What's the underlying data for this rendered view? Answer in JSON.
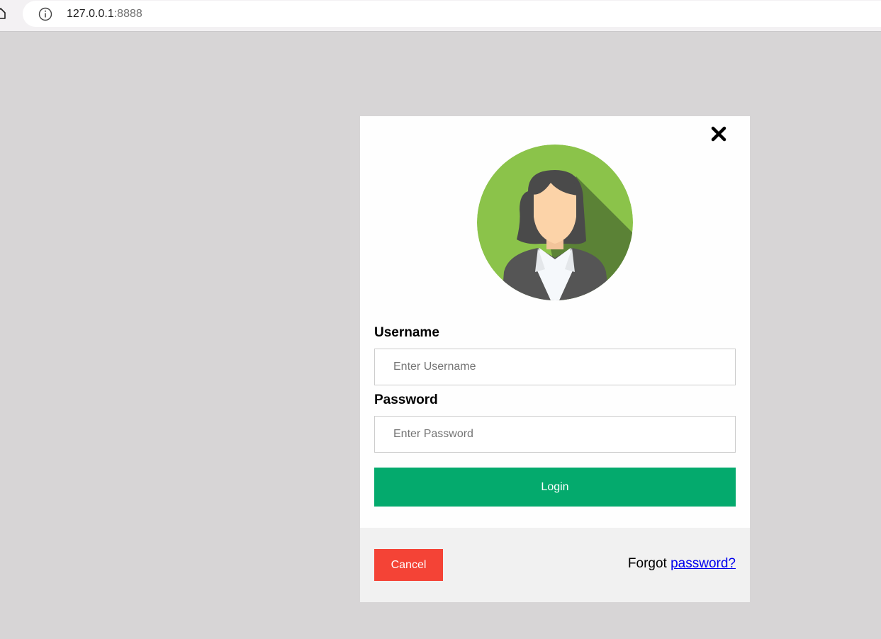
{
  "browser": {
    "url_host": "127.0.0.1",
    "url_port": ":8888"
  },
  "modal": {
    "username_label": "Username",
    "username_placeholder": "Enter Username",
    "password_label": "Password",
    "password_placeholder": "Enter Password",
    "login_label": "Login",
    "cancel_label": "Cancel",
    "forgot_prefix": "Forgot ",
    "forgot_link": "password?"
  },
  "icons": {
    "close": "close-icon",
    "avatar": "user-avatar-icon",
    "info": "info-icon",
    "home": "home-icon"
  },
  "colors": {
    "login_button": "#04aa6d",
    "cancel_button": "#f44336",
    "avatar_background": "#8bc34a",
    "link": "#0000ee"
  }
}
